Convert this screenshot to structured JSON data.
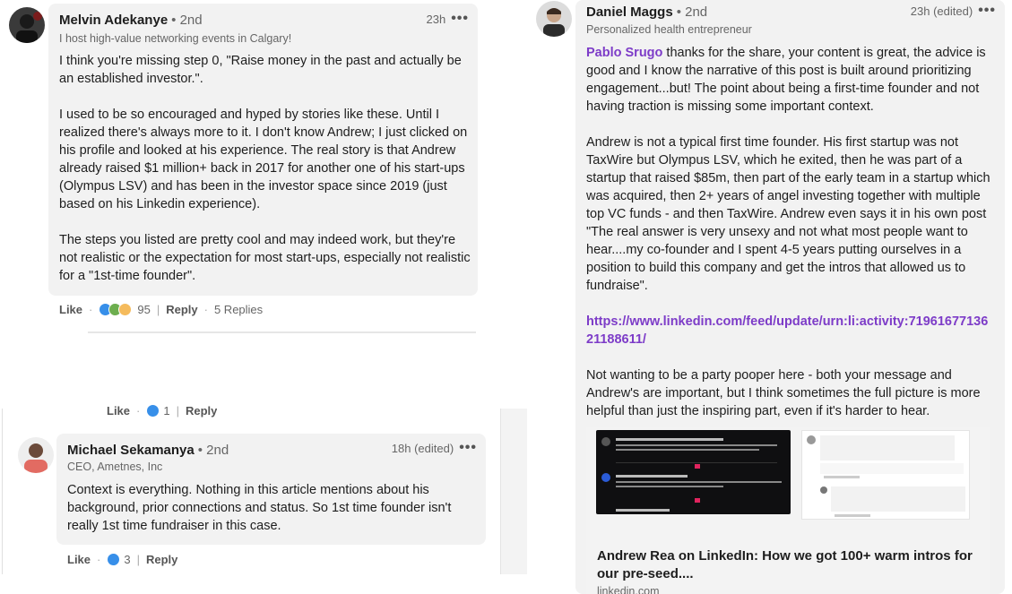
{
  "left": {
    "comment1": {
      "name": "Melvin Adekanye",
      "degree": "• 2nd",
      "headline": "I host high-value networking events in Calgary!",
      "time": "23h",
      "more": "•••",
      "body": "I think you're missing step 0, \"Raise money in the past and actually be an established investor.\".\n\nI used to be so encouraged and hyped by stories like these. Until I realized there's always more to it. I don't know Andrew; I just clicked on his profile and looked at his experience. The real story is that Andrew already raised $1 million+ back in 2017 for another one of his start-ups (Olympus LSV) and has been in the investor space since 2019 (just based on his Linkedin experience).\n\nThe steps you listed are pretty cool and may indeed work, but they're not realistic or the expectation for most start-ups, especially not realistic for a \"1st-time founder\".",
      "like": "Like",
      "reactions": "95",
      "reply": "Reply",
      "replies": "5 Replies"
    },
    "partial_row": {
      "like": "Like",
      "reactions": "1",
      "reply": "Reply"
    },
    "comment2": {
      "name": "Michael Sekamanya",
      "degree": "• 2nd",
      "headline": "CEO, Ametnes, Inc",
      "time": "18h (edited)",
      "more": "•••",
      "body": "Context is everything. Nothing in this article mentions about his background, prior connections and status. So 1st time founder isn't really 1st time fundraiser in this case.",
      "like": "Like",
      "reactions": "3",
      "reply": "Reply"
    }
  },
  "right": {
    "name": "Daniel Maggs",
    "degree": "• 2nd",
    "headline": "Personalized health entrepreneur",
    "time": "23h (edited)",
    "more": "•••",
    "mention": "Pablo Srugo",
    "p1": " thanks for the share, your content is great, the advice is good and I know the narrative of this post is built around prioritizing engagement...but! The point about being a first-time founder and not having traction is missing some important context.",
    "p2": "Andrew is not a typical first time founder. His first startup was not TaxWire but Olympus LSV, which he exited, then he was part of a startup that raised $85m, then part of the early team in a startup which was acquired, then 2+ years of angel investing together with multiple top VC funds - and then TaxWire. Andrew even says it in his own post \"The real answer is very unsexy and not what most people want to hear....my co-founder and I spent 4-5 years putting ourselves in a position to build this company and get the intros that allowed us to fundraise\".",
    "link": "https://www.linkedin.com/feed/update/urn:li:activity:71961677136 21188611/",
    "p3": "Not wanting to be a party pooper here - both your message and Andrew's are important, but I think sometimes the full picture is more helpful than just the inspiring part, even if it's harder to hear.",
    "preview_title": "Andrew Rea on LinkedIn: How we got 100+ warm intros for our pre-seed....",
    "preview_domain": "linkedin.com"
  }
}
